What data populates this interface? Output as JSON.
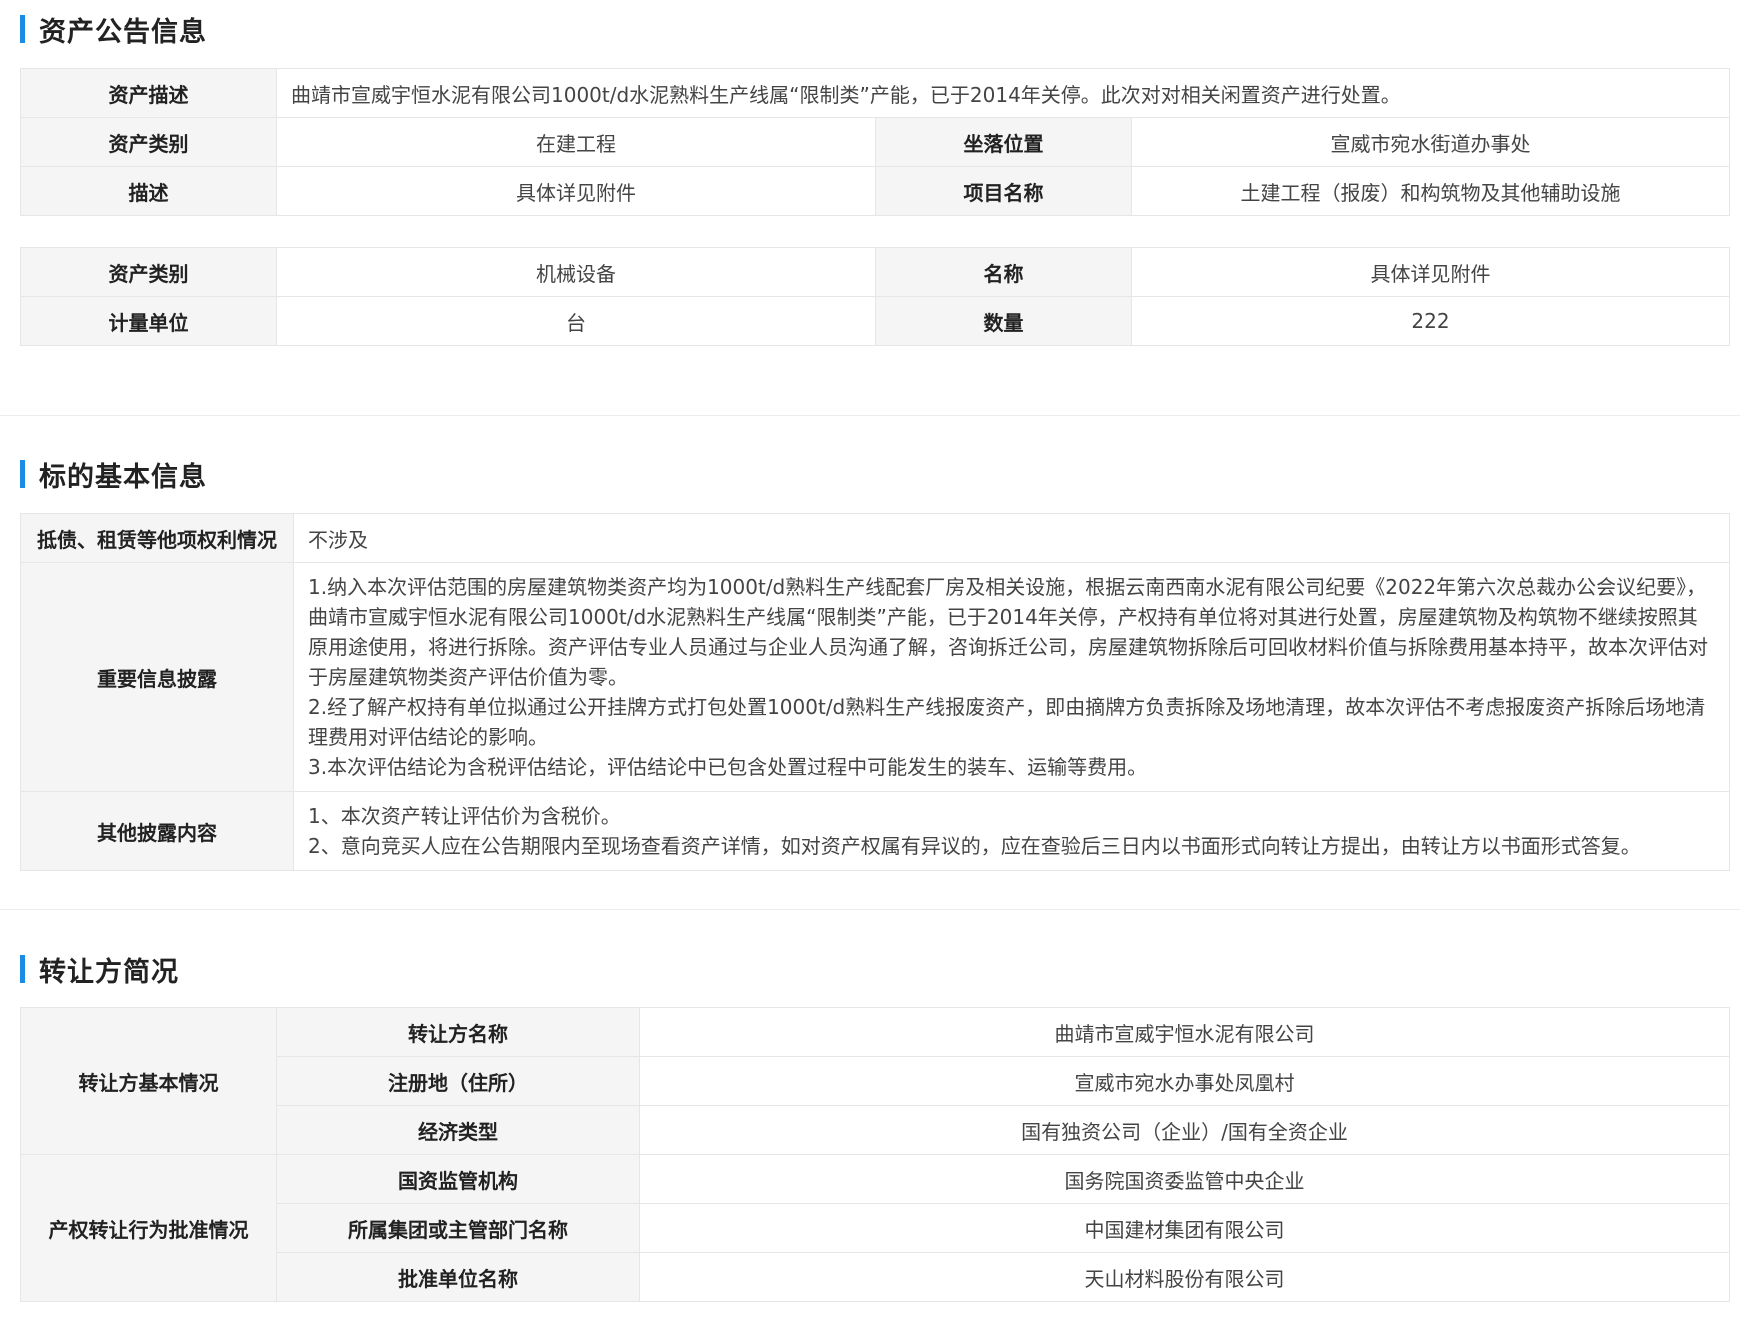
{
  "asset_notice": {
    "title": "资产公告信息",
    "description_label": "资产描述",
    "description_value": "曲靖市宣威宇恒水泥有限公司1000t/d水泥熟料生产线属“限制类”产能，已于2014年关停。此次对对相关闲置资产进行处置。",
    "table1": {
      "category_label": "资产类别",
      "category_value": "在建工程",
      "location_label": "坐落位置",
      "location_value": "宣威市宛水街道办事处",
      "desc_label": "描述",
      "desc_value": "具体详见附件",
      "project_label": "项目名称",
      "project_value": "土建工程（报废）和构筑物及其他辅助设施"
    },
    "table2": {
      "category_label": "资产类别",
      "category_value": "机械设备",
      "name_label": "名称",
      "name_value": "具体详见附件",
      "unit_label": "计量单位",
      "unit_value": "台",
      "qty_label": "数量",
      "qty_value": "222"
    }
  },
  "target_info": {
    "title": "标的基本信息",
    "rights_label": "抵债、租赁等他项权利情况",
    "rights_value": "不涉及",
    "disclosure_label": "重要信息披露",
    "disclosure_lines": [
      "1.纳入本次评估范围的房屋建筑物类资产均为1000t/d熟料生产线配套厂房及相关设施，根据云南西南水泥有限公司纪要《2022年第六次总裁办公会议纪要》，曲靖市宣威宇恒水泥有限公司1000t/d水泥熟料生产线属“限制类”产能，已于2014年关停，产权持有单位将对其进行处置，房屋建筑物及构筑物不继续按照其原用途使用，将进行拆除。资产评估专业人员通过与企业人员沟通了解，咨询拆迁公司，房屋建筑物拆除后可回收材料价值与拆除费用基本持平，故本次评估对于房屋建筑物类资产评估价值为零。",
      "2.经了解产权持有单位拟通过公开挂牌方式打包处置1000t/d熟料生产线报废资产，即由摘牌方负责拆除及场地清理，故本次评估不考虑报废资产拆除后场地清理费用对评估结论的影响。",
      "3.本次评估结论为含税评估结论，评估结论中已包含处置过程中可能发生的装车、运输等费用。"
    ],
    "other_label": "其他披露内容",
    "other_lines": [
      "1、本次资产转让评估价为含税价。",
      "2、意向竞买人应在公告期限内至现场查看资产详情，如对资产权属有异议的，应在查验后三日内以书面形式向转让方提出，由转让方以书面形式答复。"
    ]
  },
  "transferor": {
    "title": "转让方简况",
    "basic_group_label": "转让方基本情况",
    "approval_group_label": "产权转让行为批准情况",
    "rows": [
      {
        "label": "转让方名称",
        "value": "曲靖市宣威宇恒水泥有限公司"
      },
      {
        "label": "注册地（住所）",
        "value": "宣威市宛水办事处凤凰村"
      },
      {
        "label": "经济类型",
        "value": "国有独资公司（企业）/国有全资企业"
      },
      {
        "label": "国资监管机构",
        "value": "国务院国资委监管中央企业"
      },
      {
        "label": "所属集团或主管部门名称",
        "value": "中国建材集团有限公司"
      },
      {
        "label": "批准单位名称",
        "value": "天山材料股份有限公司"
      }
    ]
  }
}
